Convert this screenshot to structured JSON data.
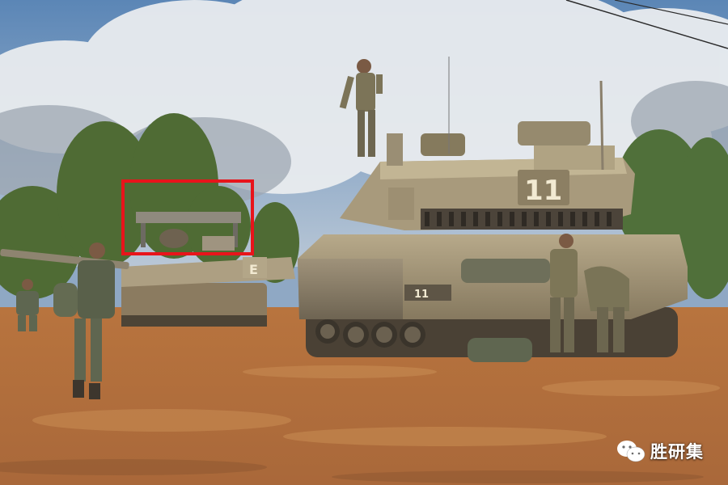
{
  "watermark": {
    "text": "胜研集",
    "icon": "wechat-icon"
  },
  "markings": {
    "main_tank_turret": "11",
    "main_tank_hull": "11"
  },
  "highlight": {
    "color": "#e8141b"
  }
}
